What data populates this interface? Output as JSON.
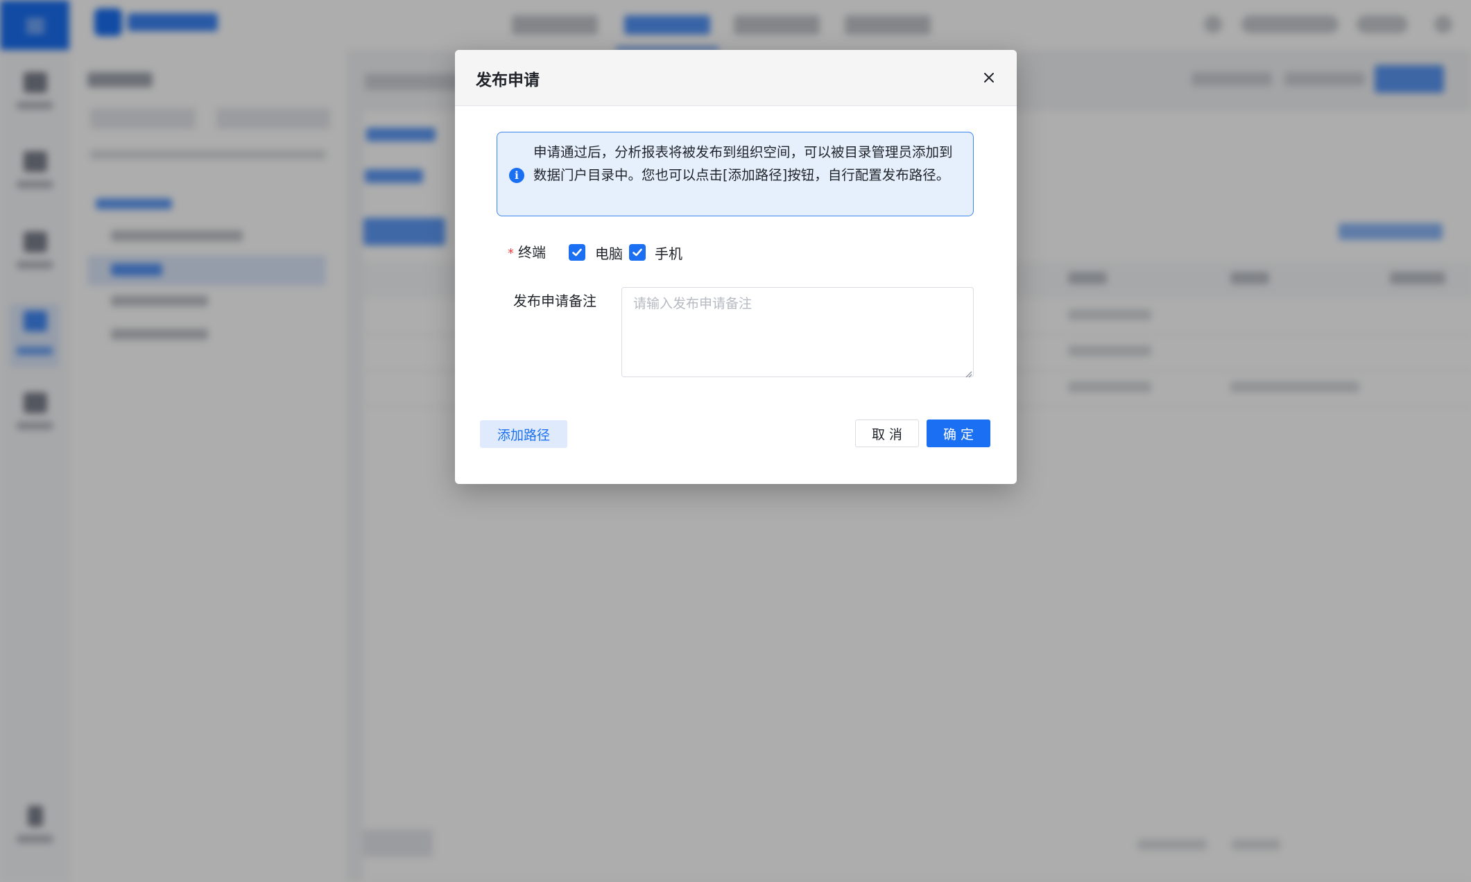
{
  "dialog": {
    "title": "发布申请",
    "close_icon": "close-icon",
    "info": {
      "icon": "info-icon",
      "icon_glyph": "i",
      "text": "申请通过后，分析报表将被发布到组织空间，可以被目录管理员添加到数据门户目录中。您也可以点击[添加路径]按钮，自行配置发布路径。"
    },
    "terminal": {
      "required_mark": "*",
      "label": "终端",
      "options": [
        {
          "label": "电脑",
          "checked": true
        },
        {
          "label": "手机",
          "checked": true
        }
      ]
    },
    "remark": {
      "label": "发布申请备注",
      "value": "",
      "placeholder": "请输入发布申请备注"
    },
    "buttons": {
      "add_path": "添加路径",
      "cancel": "取 消",
      "ok": "确 定"
    }
  },
  "colors": {
    "accent": "#1a6ff2",
    "info_bg": "#e6f0fd",
    "required": "#f53f3f",
    "overlay": "rgba(0,0,0,0.32)"
  }
}
